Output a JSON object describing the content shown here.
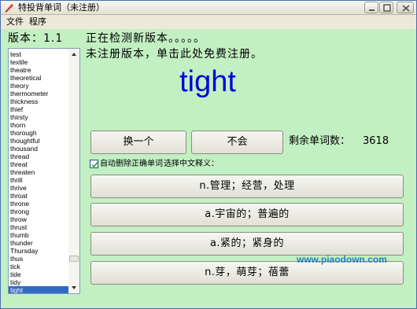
{
  "window": {
    "title": "特投背单词（未注册）"
  },
  "menu": [
    {
      "label": "文件"
    },
    {
      "label": "程序"
    }
  ],
  "version_label": "版本：1.1",
  "status": {
    "checking": "正在检测新版本。。。。。",
    "register": "未注册版本，单击此处免费注册。"
  },
  "word_list": {
    "items": [
      "test",
      "textile",
      "theatre",
      "theoretical",
      "theory",
      "thermometer",
      "thickness",
      "thief",
      "thirsty",
      "thorn",
      "thorough",
      "thoughtful",
      "thousand",
      "thread",
      "threat",
      "threaten",
      "thrill",
      "thrive",
      "throat",
      "throne",
      "throng",
      "throw",
      "thrust",
      "thumb",
      "thunder",
      "Thursday",
      "thus",
      "tick",
      "tide",
      "tidy",
      "tight"
    ],
    "selected": "tight"
  },
  "current_word": "tight",
  "buttons": {
    "change": "换一个",
    "unknown": "不会"
  },
  "remaining": {
    "label": "剩余单词数：",
    "count": "3618"
  },
  "options": {
    "auto_delete_label": "自动删除正确单词",
    "auto_delete_checked": true,
    "choose_label": "选择中文释义："
  },
  "choices": [
    "n.管理；经营，处理",
    "a.宇宙的；普遍的",
    "a.紧的；紧身的",
    "n.芽，萌芽；蓓蕾"
  ],
  "watermark": "www.piaodown.com",
  "colors": {
    "background": "#c2f0c2",
    "word": "#0000e0",
    "selection": "#316ac5",
    "watermark": "#2c7ec0"
  }
}
